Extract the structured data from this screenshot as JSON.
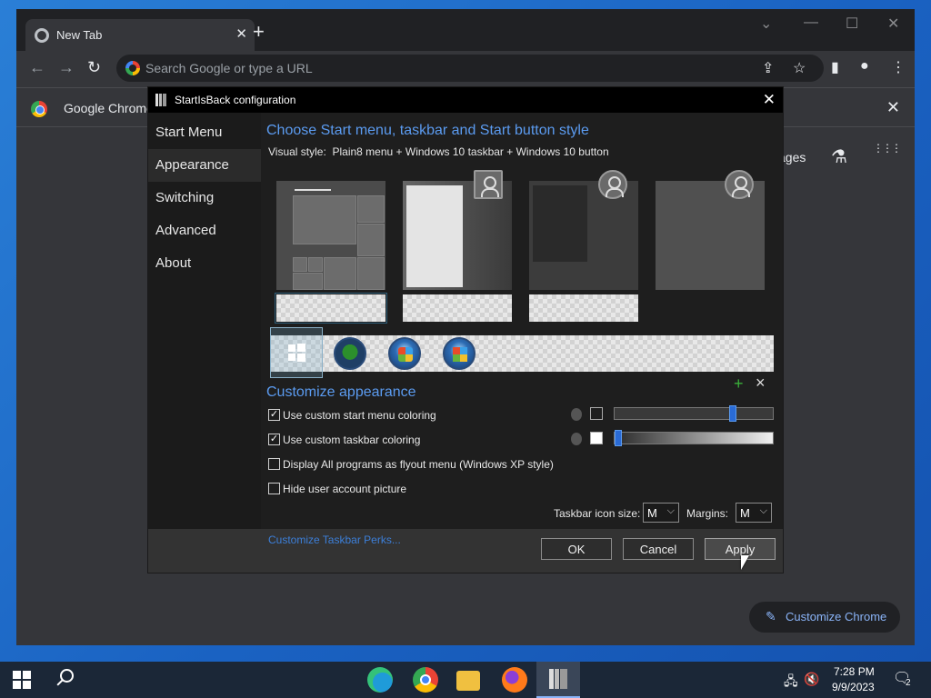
{
  "browser": {
    "tab_title": "New Tab",
    "omnibox_placeholder": "Search Google or type a URL",
    "infobar_text": "Google Chrome",
    "ntp_link_partial": "ages",
    "customize_label": "Customize Chrome"
  },
  "dialog": {
    "title": "StartIsBack configuration",
    "sidebar": [
      "Start Menu",
      "Appearance",
      "Switching",
      "Advanced",
      "About"
    ],
    "selected": "Appearance",
    "heading_style": "Choose Start menu, taskbar and Start button style",
    "visual_style_label": "Visual style:",
    "visual_style_value": "Plain8 menu + Windows 10 taskbar + Windows 10 button",
    "heading_customize": "Customize appearance",
    "options": [
      {
        "label": "Use custom start menu coloring",
        "checked": true
      },
      {
        "label": "Use custom taskbar coloring",
        "checked": true
      },
      {
        "label": "Display All programs as flyout menu (Windows XP style)",
        "checked": false
      },
      {
        "label": "Hide user account picture",
        "checked": false
      }
    ],
    "check_glyph": "✓",
    "start_menu_slider": 0.76,
    "taskbar_slider": 0.0,
    "add_icon": "+",
    "remove_icon": "×",
    "link": "Customize Taskbar Perks...",
    "taskbar_icon_size_label": "Taskbar icon size:",
    "taskbar_icon_size_value": "M",
    "margins_label": "Margins:",
    "margins_value": "M",
    "chevron_glyph": "⌵",
    "buttons": {
      "ok": "OK",
      "cancel": "Cancel",
      "apply": "Apply"
    }
  },
  "taskbar": {
    "time": "7:28 PM",
    "date": "9/9/2023",
    "notifications": "2"
  },
  "glyphs": {
    "close": "✕",
    "plus": "+",
    "back": "←",
    "forward": "→",
    "reload": "↻",
    "share": "⇪",
    "star": "☆",
    "side_panel": "▮",
    "profile": "●",
    "menu": "⋮",
    "minimize": "—",
    "maximize": "☐",
    "chevron_down": "⌄",
    "flask": "⚗",
    "apps": "⋮⋮⋮",
    "pencil": "✎",
    "network": "🖧",
    "volume_muted": "🔇",
    "notification": "🗨"
  }
}
